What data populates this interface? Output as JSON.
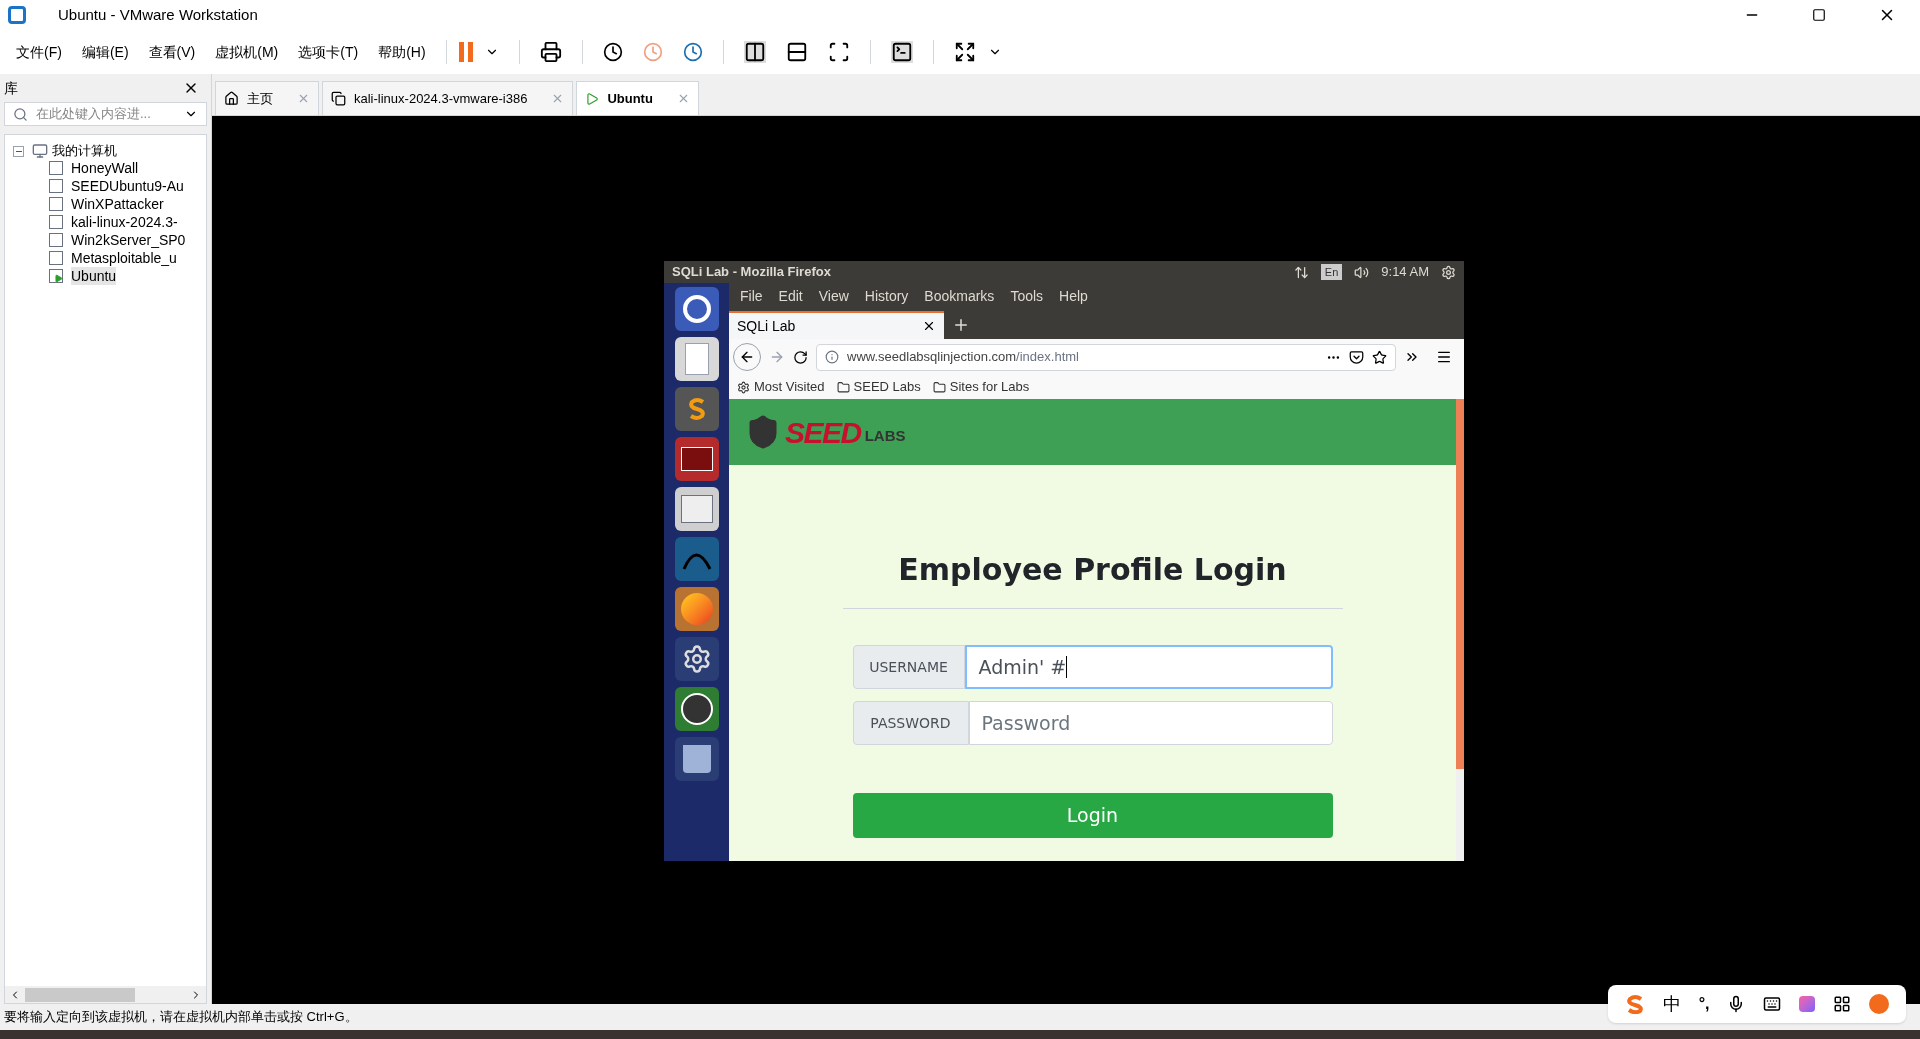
{
  "window": {
    "title": "Ubuntu - VMware Workstation"
  },
  "menu": [
    "文件(F)",
    "编辑(E)",
    "查看(V)",
    "虚拟机(M)",
    "选项卡(T)",
    "帮助(H)"
  ],
  "library": {
    "title": "库",
    "search": {
      "placeholder": "在此处键入内容进..."
    },
    "tree": {
      "label": "我的计算机",
      "expanded": true,
      "children": [
        {
          "label": "HoneyWall",
          "selected": false,
          "running": false
        },
        {
          "label": "SEEDUbuntu9-Au",
          "selected": false,
          "running": false
        },
        {
          "label": "WinXPattacker",
          "selected": false,
          "running": false
        },
        {
          "label": "kali-linux-2024.3-",
          "selected": false,
          "running": false
        },
        {
          "label": "Win2kServer_SP0",
          "selected": false,
          "running": false
        },
        {
          "label": "Metasploitable_u",
          "selected": false,
          "running": false
        },
        {
          "label": "Ubuntu",
          "selected": true,
          "running": true
        }
      ]
    }
  },
  "tabs": [
    {
      "label": "主页",
      "kind": "home",
      "selected": false
    },
    {
      "label": "kali-linux-2024.3-vmware-i386",
      "kind": "vm",
      "selected": false
    },
    {
      "label": "Ubuntu",
      "kind": "vm-running",
      "selected": true
    }
  ],
  "vm": {
    "panel": {
      "title": "SQLi Lab - Mozilla Firefox",
      "keyboard": "En",
      "time": "9:14 AM"
    },
    "firefox": {
      "menu": [
        "File",
        "Edit",
        "View",
        "History",
        "Bookmarks",
        "Tools",
        "Help"
      ],
      "tab": "SQLi Lab",
      "url": {
        "domain": "www.seedlabsqlinjection.com",
        "path": "/index.html"
      },
      "bookmarks": [
        {
          "label": "Most Visited",
          "kind": "gear"
        },
        {
          "label": "SEED Labs",
          "kind": "folder"
        },
        {
          "label": "Sites for Labs",
          "kind": "folder"
        }
      ],
      "page": {
        "logo": {
          "word": "SEED",
          "sub": "LABS"
        },
        "heading": "Employee Profile Login",
        "username": {
          "label": "USERNAME",
          "value": "Admin' #",
          "focused": true
        },
        "password": {
          "label": "PASSWORD",
          "placeholder": "Password"
        },
        "button": "Login"
      }
    }
  },
  "status_bar": "要将输入定向到该虚拟机，请在虚拟机内部单击或按 Ctrl+G。",
  "ime": {
    "mode": "中",
    "punctuation": "°,"
  }
}
